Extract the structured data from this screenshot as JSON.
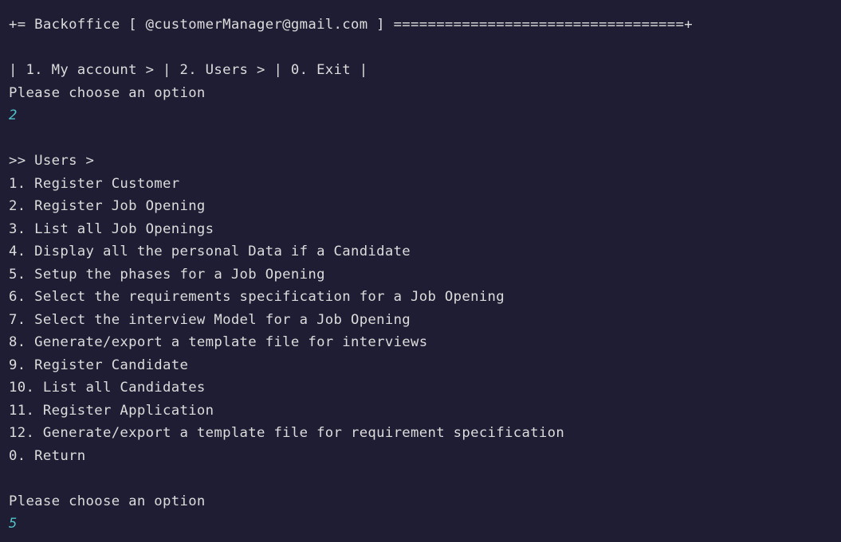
{
  "header": {
    "title_line": "+= Backoffice [ @customerManager@gmail.com ] ==================================+"
  },
  "main_menu": {
    "line": "| 1. My account > | 2. Users > | 0. Exit |",
    "prompt": "Please choose an option",
    "input_value": "2"
  },
  "users_menu": {
    "heading": ">> Users >",
    "items": [
      "1. Register Customer",
      "2. Register Job Opening",
      "3. List all Job Openings",
      "4. Display all the personal Data if a Candidate",
      "5. Setup the phases for a Job Opening",
      "6. Select the requirements specification for a Job Opening",
      "7. Select the interview Model for a Job Opening",
      "8. Generate/export a template file for interviews",
      "9. Register Candidate",
      "10. List all Candidates",
      "11. Register Application",
      "12. Generate/export a template file for requirement specification",
      "0. Return"
    ],
    "prompt": "Please choose an option",
    "input_value": "5"
  },
  "colors": {
    "background": "#1f1d33",
    "text": "#dcdcdc",
    "input": "#4fc1c7"
  }
}
